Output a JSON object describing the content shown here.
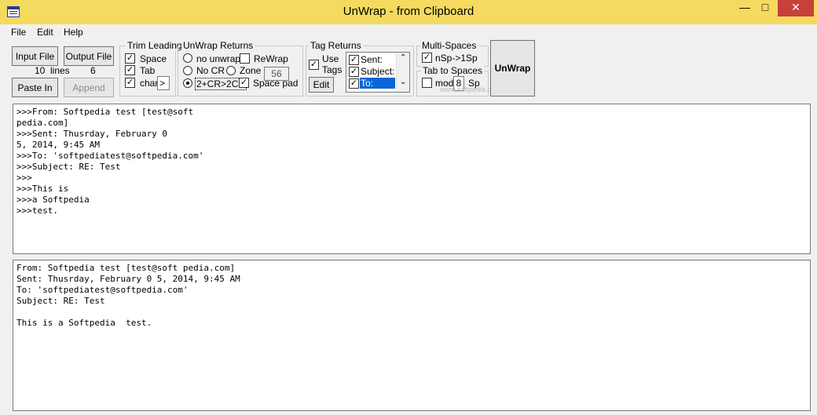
{
  "window": {
    "title": "UnWrap - from Clipboard"
  },
  "menu": [
    "File",
    "Edit",
    "Help"
  ],
  "buttons": {
    "input_file": "Input File",
    "output_file": "Output File",
    "paste_in": "Paste In",
    "append": "Append",
    "edit": "Edit",
    "unwrap": "UnWrap"
  },
  "counts": {
    "lines_in": "10",
    "lines_label": "lines",
    "lines_out": "6"
  },
  "trim_leading": {
    "title": "Trim Leading",
    "space": "Space",
    "tab": "Tab",
    "char": "char",
    "char_value": ">"
  },
  "unwrap_returns": {
    "title": "UnWrap Returns",
    "no_unwrap": "no unwrap",
    "rewrap": "ReWrap",
    "no_cr": "No CR",
    "zone": "Zone",
    "zone_value": "56",
    "two_cr": "2+CR>2CR",
    "space_pad": "Space pad"
  },
  "tag_returns": {
    "title": "Tag Returns",
    "use_tags": "Use Tags",
    "tags": [
      "Sent:",
      "Subject:",
      "To:"
    ]
  },
  "multi_spaces": {
    "title": "Multi-Spaces",
    "nsp": "nSp->1Sp"
  },
  "tab_to_spaces": {
    "title": "Tab to Spaces",
    "mod": "mod",
    "mod_value": "8",
    "sp": "Sp"
  },
  "watermark": "www.softpedia.com",
  "input_text": ">>>From: Softpedia test [test@soft\npedia.com]\n>>>Sent: Thusrday, February 0\n5, 2014, 9:45 AM\n>>>To: 'softpediatest@softpedia.com'\n>>>Subject: RE: Test\n>>>\n>>>This is\n>>>a Softpedia\n>>>test.",
  "output_text": "From: Softpedia test [test@soft pedia.com]\nSent: Thusrday, February 0 5, 2014, 9:45 AM\nTo: 'softpediatest@softpedia.com'\nSubject: RE: Test\n\nThis is a Softpedia  test."
}
